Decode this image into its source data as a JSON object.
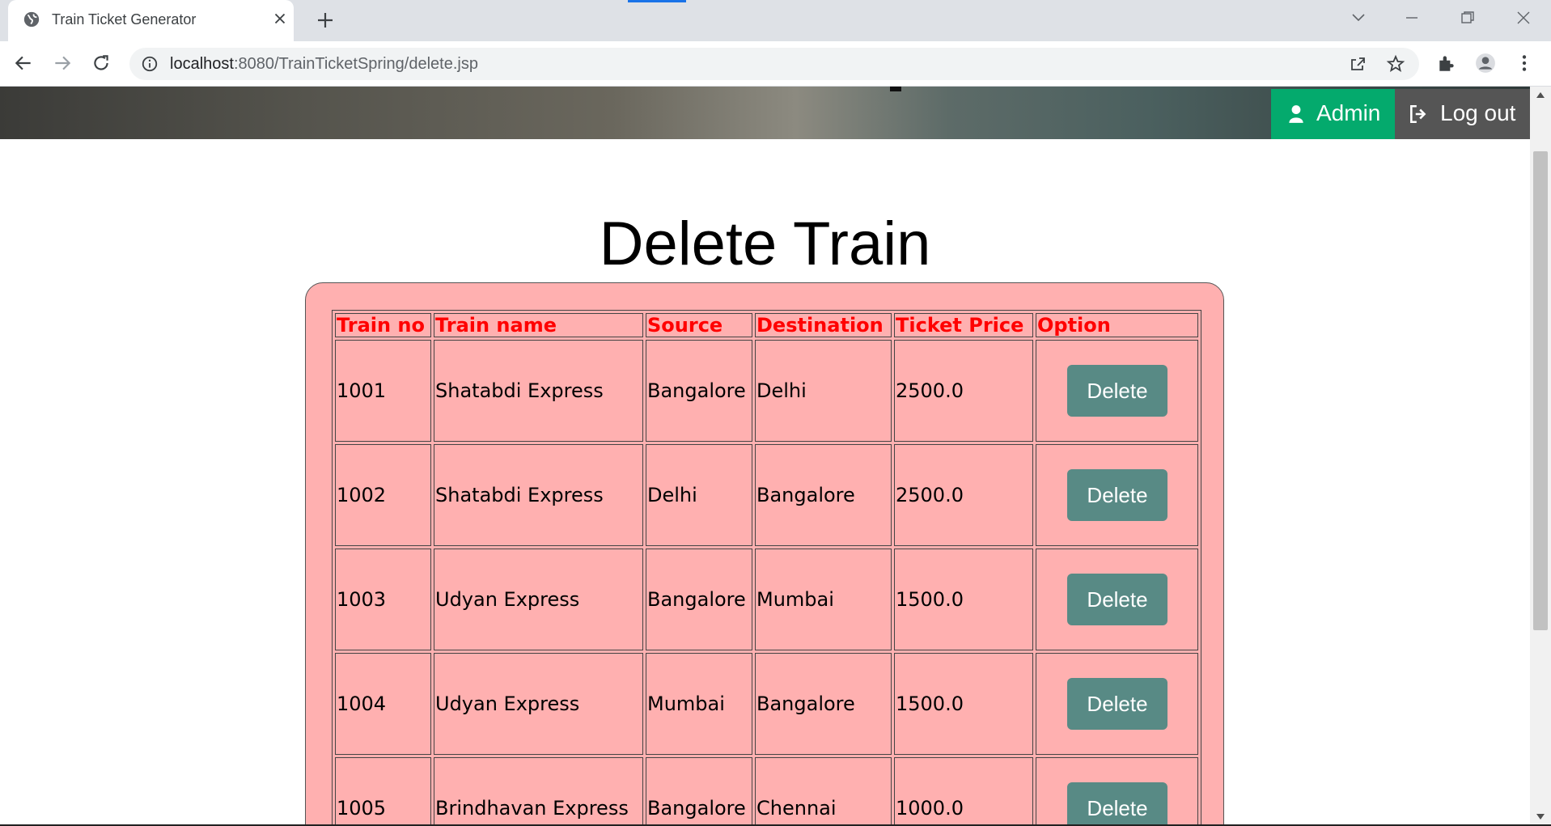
{
  "browser": {
    "tab_title": "Train Ticket Generator",
    "url_host": "localhost",
    "url_path": ":8080/TrainTicketSpring/delete.jsp"
  },
  "nav": {
    "admin_label": "Admin",
    "logout_label": "Log out"
  },
  "page": {
    "title": "Delete Train"
  },
  "table": {
    "headers": [
      "Train no",
      "Train name",
      "Source",
      "Destination",
      "Ticket Price",
      "Option"
    ],
    "rows": [
      {
        "no": "1001",
        "name": "Shatabdi Express",
        "source": "Bangalore",
        "destination": "Delhi",
        "price": "2500.0",
        "action": "Delete"
      },
      {
        "no": "1002",
        "name": "Shatabdi Express",
        "source": "Delhi",
        "destination": "Bangalore",
        "price": "2500.0",
        "action": "Delete"
      },
      {
        "no": "1003",
        "name": "Udyan Express",
        "source": "Bangalore",
        "destination": "Mumbai",
        "price": "1500.0",
        "action": "Delete"
      },
      {
        "no": "1004",
        "name": "Udyan Express",
        "source": "Mumbai",
        "destination": "Bangalore",
        "price": "1500.0",
        "action": "Delete"
      },
      {
        "no": "1005",
        "name": "Brindhavan Express",
        "source": "Bangalore",
        "destination": "Chennai",
        "price": "1000.0",
        "action": "Delete"
      }
    ]
  },
  "icons": {
    "favicon": "globe-icon",
    "admin": "user-icon",
    "logout": "sign-out-icon"
  },
  "colors": {
    "admin_bg": "#04aa6d",
    "logout_bg": "#555555",
    "card_bg": "#ffb0b0",
    "header_text": "#ff0000",
    "delete_btn": "#588a85"
  }
}
